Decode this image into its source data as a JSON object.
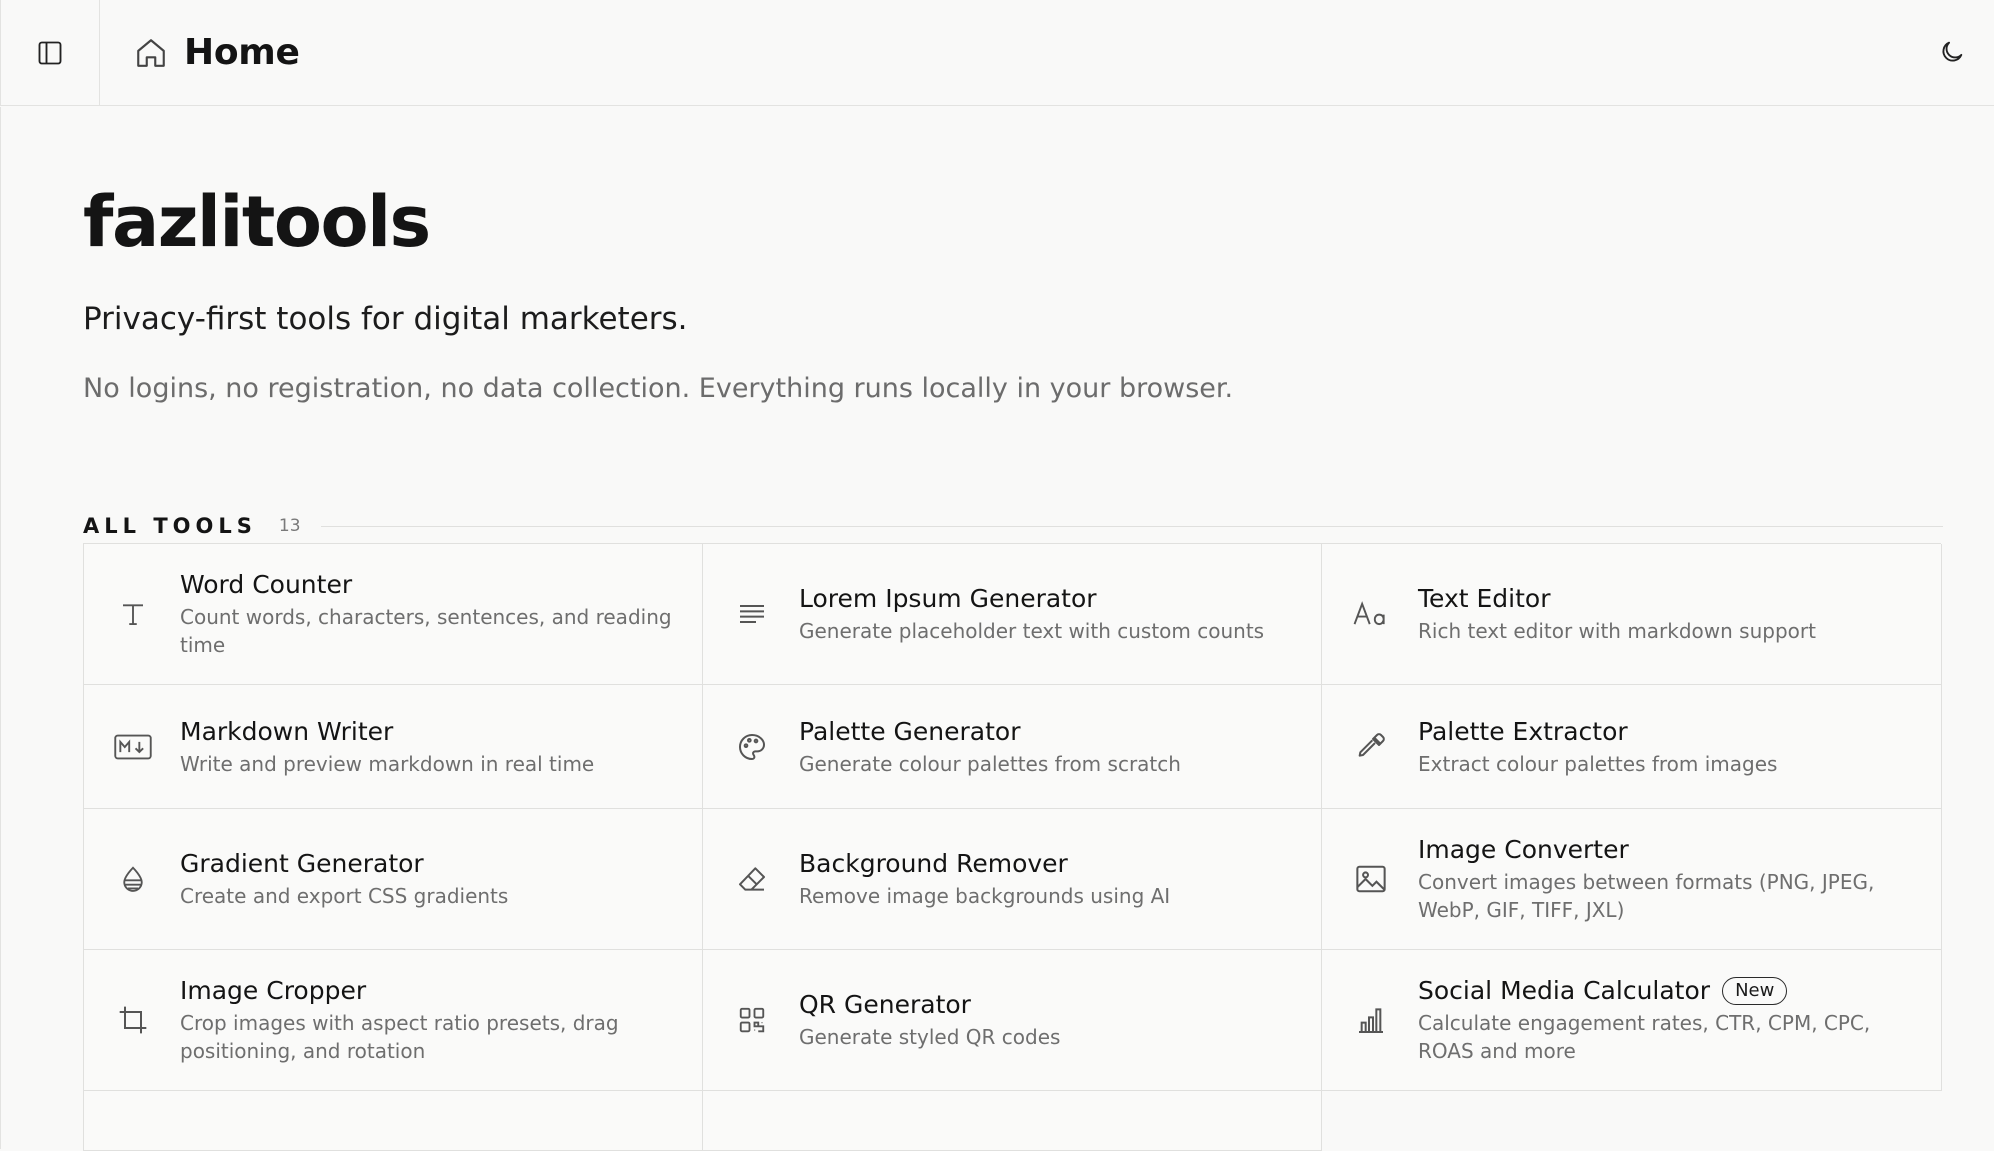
{
  "header": {
    "title": "Home"
  },
  "hero": {
    "site_title": "fazlitools",
    "tagline": "Privacy-first tools for digital marketers.",
    "subline": "No logins, no registration, no data collection. Everything runs locally in your browser."
  },
  "section": {
    "label": "ALL TOOLS",
    "count": "13"
  },
  "tools": [
    {
      "name": "Word Counter",
      "desc": "Count words, characters, sentences, and reading time",
      "icon": "type-icon"
    },
    {
      "name": "Lorem Ipsum Generator",
      "desc": "Generate placeholder text with custom counts",
      "icon": "text-lines-icon"
    },
    {
      "name": "Text Editor",
      "desc": "Rich text editor with markdown support",
      "icon": "font-case-icon"
    },
    {
      "name": "Markdown Writer",
      "desc": "Write and preview markdown in real time",
      "icon": "markdown-icon"
    },
    {
      "name": "Palette Generator",
      "desc": "Generate colour palettes from scratch",
      "icon": "palette-icon"
    },
    {
      "name": "Palette Extractor",
      "desc": "Extract colour palettes from images",
      "icon": "eyedropper-icon"
    },
    {
      "name": "Gradient Generator",
      "desc": "Create and export CSS gradients",
      "icon": "droplet-icon"
    },
    {
      "name": "Background Remover",
      "desc": "Remove image backgrounds using AI",
      "icon": "eraser-icon"
    },
    {
      "name": "Image Converter",
      "desc": "Convert images between formats (PNG, JPEG, WebP, GIF, TIFF, JXL)",
      "icon": "image-icon"
    },
    {
      "name": "Image Cropper",
      "desc": "Crop images with aspect ratio presets, drag positioning, and rotation",
      "icon": "crop-icon"
    },
    {
      "name": "QR Generator",
      "desc": "Generate styled QR codes",
      "icon": "qr-code-icon"
    },
    {
      "name": "Social Media Calculator",
      "badge": "New",
      "desc": "Calculate engagement rates, CTR, CPM, CPC, ROAS and more",
      "icon": "bar-chart-icon"
    }
  ]
}
